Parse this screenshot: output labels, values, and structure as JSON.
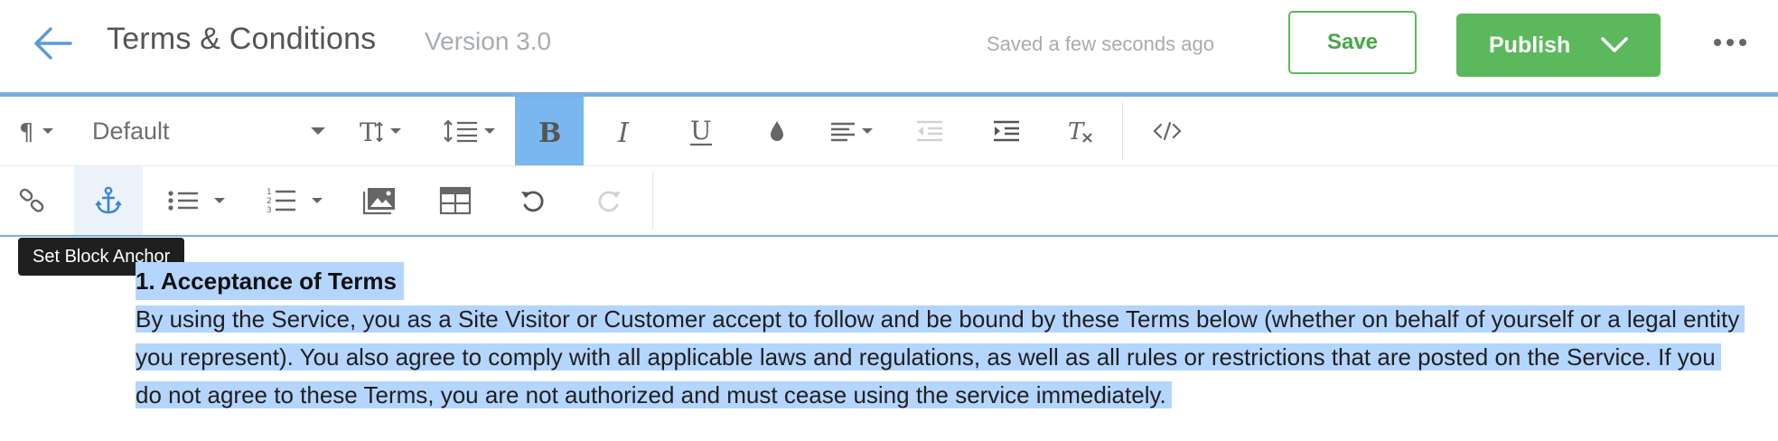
{
  "header": {
    "title": "Terms & Conditions",
    "version": "Version 3.0",
    "saved_status": "Saved a few seconds ago",
    "save_label": "Save",
    "publish_label": "Publish",
    "back_icon": "arrow-left-icon",
    "more_icon": "more-horizontal-icon"
  },
  "toolbar": {
    "font_style": "Default",
    "row1_icons": [
      "paragraph-icon",
      "text-size-icon",
      "line-height-icon",
      "bold-icon",
      "italic-icon",
      "underline-icon",
      "text-color-icon",
      "align-icon",
      "outdent-icon",
      "indent-icon",
      "clear-format-icon",
      "code-icon"
    ],
    "row2_icons": [
      "link-icon",
      "anchor-icon",
      "bullet-list-icon",
      "numbered-list-icon",
      "image-icon",
      "table-icon",
      "undo-icon",
      "redo-icon"
    ],
    "active": [
      "bold",
      "anchor"
    ]
  },
  "tooltip": {
    "text": "Set Block Anchor"
  },
  "content": {
    "heading": "1. Acceptance of Terms",
    "paragraph": "By using the Service, you as a Site Visitor or Customer accept to follow and be bound by these Terms below (whether on behalf of yourself or a legal entity you represent). You also agree to comply with all applicable laws and regulations, as well as all rules or restrictions that are posted on the Service. If you do not agree to these Terms, you are not authorized and must cease using the service immediately."
  },
  "colors": {
    "accent_blue": "#79b0e6",
    "publish_green": "#5cb85c",
    "selection": "#b4d5fe",
    "bold_active": "#7ab7ef"
  }
}
